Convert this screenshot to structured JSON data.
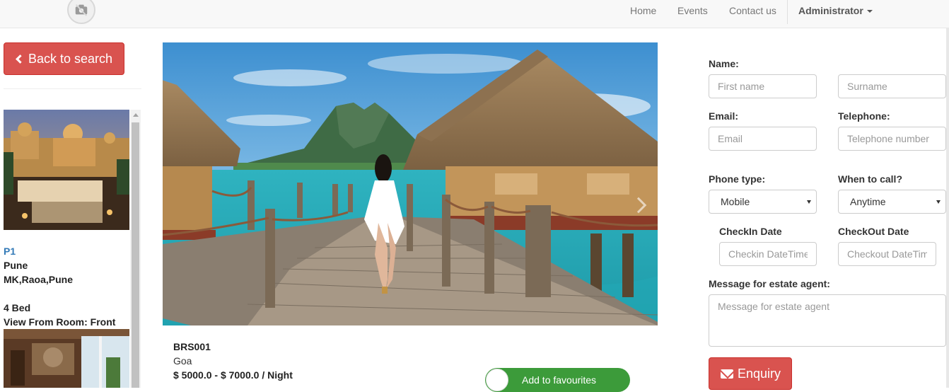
{
  "nav": {
    "links": [
      "Home",
      "Events",
      "Contact us"
    ],
    "user": "Administrator"
  },
  "left": {
    "back_label": "Back to search",
    "property": {
      "id": "P1",
      "city": "Pune",
      "address": "MK,Raoa,Pune",
      "beds": "4 Bed",
      "view": "View From Room: Front"
    }
  },
  "listing": {
    "code": "BRS001",
    "city": "Goa",
    "price": "$ 5000.0 - $ 7000.0 / Night",
    "favourite_label": "Add to favourites"
  },
  "form": {
    "name_label": "Name:",
    "first_placeholder": "First name",
    "surname_placeholder": "Surname",
    "email_label": "Email:",
    "email_placeholder": "Email",
    "telephone_label": "Telephone:",
    "telephone_placeholder": "Telephone number",
    "phone_type_label": "Phone type:",
    "phone_type_value": "Mobile",
    "when_label": "When to call?",
    "when_value": "Anytime",
    "checkin_label": "CheckIn Date",
    "checkin_placeholder": "Checkin DateTime",
    "checkout_label": "CheckOut Date",
    "checkout_placeholder": "Checkout DateTime",
    "message_label": "Message for estate agent:",
    "message_placeholder": "Message for estate agent",
    "enquiry_label": "Enquiry"
  },
  "colors": {
    "danger": "#d9534f",
    "success": "#3c9b3a",
    "link": "#337ab7"
  }
}
